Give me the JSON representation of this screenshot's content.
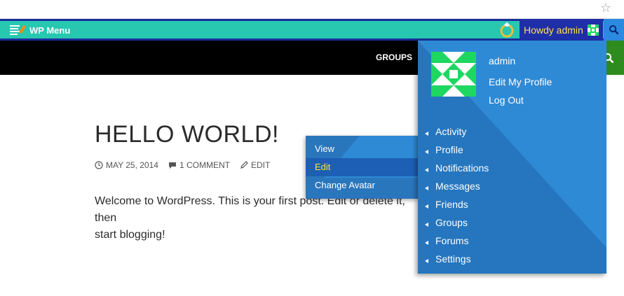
{
  "adminbar": {
    "menu_label": "WP Menu",
    "howdy": "Howdy admin"
  },
  "site_nav": {
    "groups": "GROUPS"
  },
  "post": {
    "title": "HELLO WORLD!",
    "date": "MAY 25, 2014",
    "comments": "1 COMMENT",
    "edit": "EDIT",
    "body_line1": "Welcome to WordPress. This is your first post. Edit or delete it, then",
    "body_line2": "start blogging!"
  },
  "profile_submenu": {
    "items": [
      "View",
      "Edit",
      "Change Avatar"
    ],
    "active": "Edit"
  },
  "profile_dropdown": {
    "name": "admin",
    "edit_profile": "Edit My Profile",
    "logout": "Log Out",
    "items": [
      "Activity",
      "Profile",
      "Notifications",
      "Messages",
      "Friends",
      "Groups",
      "Forums",
      "Settings"
    ]
  },
  "colors": {
    "adminbar_accent": "#27c7b0",
    "adminbar_dark": "#1a2f9a",
    "dropdown": "#2576be",
    "dropdown_light": "#2f8ad6",
    "highlight_text": "#ffe14a",
    "search_green": "#2e8b1e"
  }
}
